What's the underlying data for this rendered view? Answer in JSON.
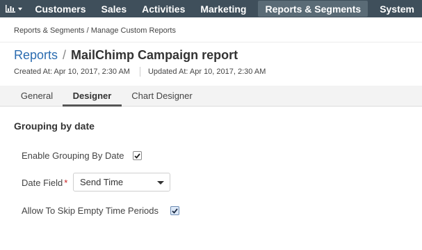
{
  "nav": {
    "chart_icon": "bar-chart-icon",
    "items": [
      {
        "label": "Customers"
      },
      {
        "label": "Sales"
      },
      {
        "label": "Activities"
      },
      {
        "label": "Marketing"
      },
      {
        "label": "Reports & Segments",
        "active": true
      },
      {
        "label": "System"
      }
    ]
  },
  "breadcrumb": {
    "root": "Reports & Segments",
    "separator": "/",
    "current": "Manage Custom Reports"
  },
  "header": {
    "parent": "Reports",
    "separator": "/",
    "title": "MailChimp Campaign report",
    "created": "Created At: Apr 10, 2017, 2:30 AM",
    "updated": "Updated At: Apr 10, 2017, 2:30 AM"
  },
  "tabs": [
    {
      "label": "General"
    },
    {
      "label": "Designer",
      "active": true
    },
    {
      "label": "Chart Designer"
    }
  ],
  "section": {
    "title": "Grouping by date",
    "enable_grouping_label": "Enable Grouping By Date",
    "enable_grouping_checked": true,
    "date_field_label": "Date Field",
    "date_field_required_mark": "*",
    "date_field_value": "Send Time",
    "skip_empty_label": "Allow To Skip Empty Time Periods",
    "skip_empty_checked": true
  },
  "colors": {
    "nav_bg": "#3f4f5b",
    "nav_active": "#5a6b76",
    "link": "#2b6cb0",
    "required": "#c81e1e"
  }
}
